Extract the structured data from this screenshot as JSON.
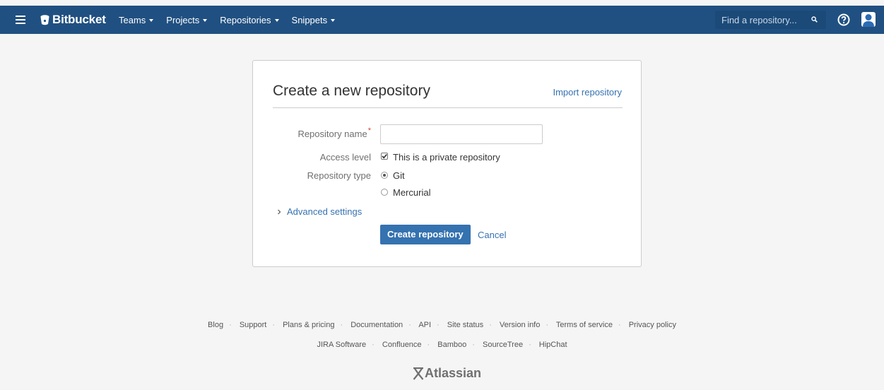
{
  "header": {
    "logo_text": "Bitbucket",
    "nav": [
      {
        "label": "Teams"
      },
      {
        "label": "Projects"
      },
      {
        "label": "Repositories"
      },
      {
        "label": "Snippets"
      }
    ],
    "search_placeholder": "Find a repository...",
    "bg_color": "#205081"
  },
  "form": {
    "title": "Create a new repository",
    "import_link": "Import repository",
    "repo_name_label": "Repository name",
    "required_mark": "*",
    "repo_name_value": "",
    "access_label": "Access level",
    "access_option": "This is a private repository",
    "access_checked": true,
    "type_label": "Repository type",
    "type_options": [
      {
        "label": "Git",
        "selected": true
      },
      {
        "label": "Mercurial",
        "selected": false
      }
    ],
    "advanced_label": "Advanced settings",
    "create_button": "Create repository",
    "cancel_link": "Cancel",
    "accent_color": "#3572b0"
  },
  "footer": {
    "links_row1": [
      "Blog",
      "Support",
      "Plans & pricing",
      "Documentation",
      "API",
      "Site status",
      "Version info",
      "Terms of service",
      "Privacy policy"
    ],
    "links_row2": [
      "JIRA Software",
      "Confluence",
      "Bamboo",
      "SourceTree",
      "HipChat"
    ],
    "brand": "Atlassian"
  }
}
